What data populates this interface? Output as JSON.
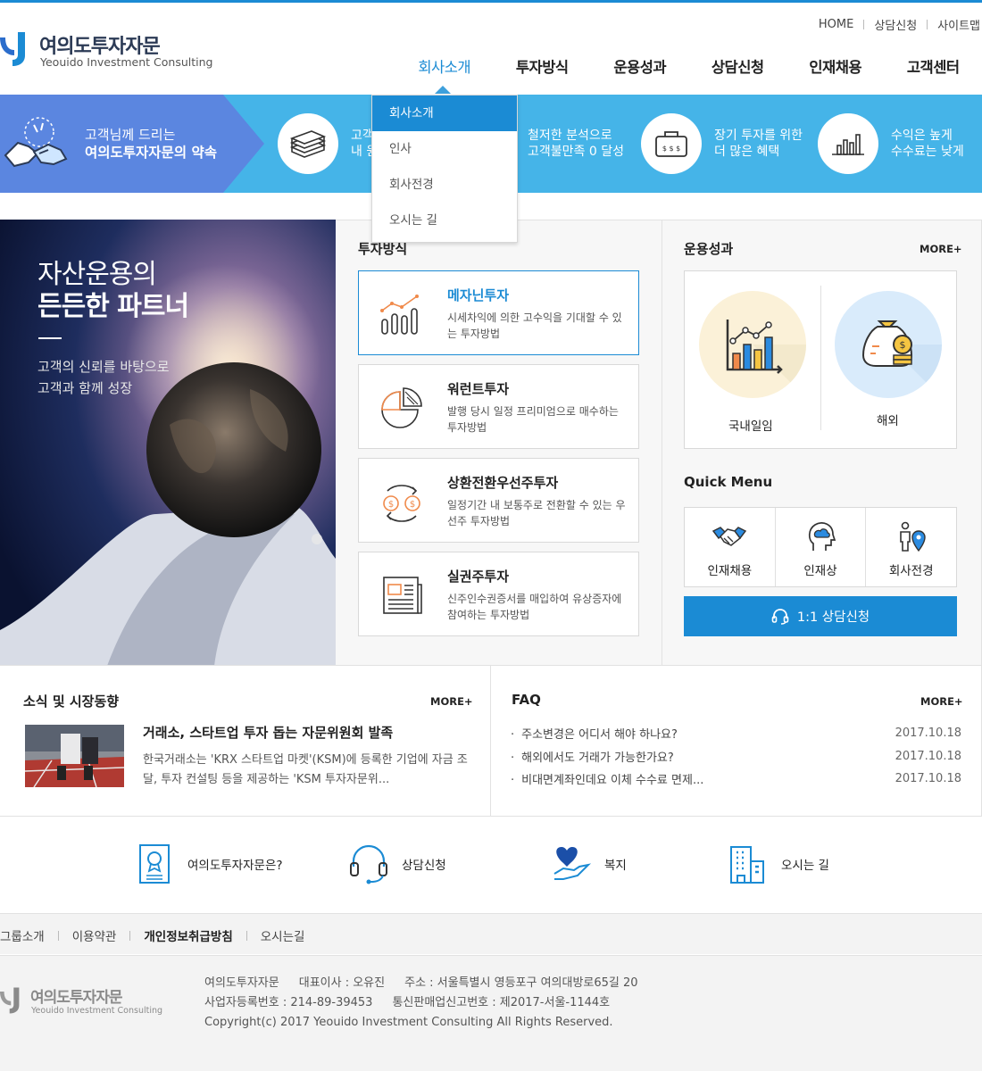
{
  "brand": {
    "name_ko": "여의도투자자문",
    "name_en": "Yeouido Investment Consulting"
  },
  "util_nav": [
    "HOME",
    "상담신청",
    "사이트맵"
  ],
  "gnb": [
    "회사소개",
    "투자방식",
    "운용성과",
    "상담신청",
    "인재채용",
    "고객센터"
  ],
  "gnb_active": "회사소개",
  "dropdown": [
    "회사소개",
    "인사",
    "회사전경",
    "오시는 길"
  ],
  "promise": {
    "title_line1": "고객님께 드리는",
    "title_line2": "여의도투자자문의 약속",
    "items": [
      {
        "icon": "money-stack-icon",
        "line1": "고객",
        "line2": "내 원"
      },
      {
        "icon": "analysis-icon",
        "line1": "철저한 분석으로",
        "line2": "고객불만족 0 달성"
      },
      {
        "icon": "benefit-box-icon",
        "line1": "장기 투자를 위한",
        "line2": "더 많은 혜택"
      },
      {
        "icon": "chart-bars-icon",
        "line1": "수익은 높게",
        "line2": "수수료는 낮게"
      }
    ]
  },
  "hero": {
    "line1": "자산운용의",
    "line2": "든든한 파트너",
    "sub1": "고객의 신뢰를 바탕으로",
    "sub2": "고객과 함께 성장"
  },
  "invest": {
    "title": "투자방식",
    "items": [
      {
        "title": "메자닌투자",
        "desc": "시세차익에 의한 고수익을 기대할 수 있는 투자방법",
        "icon": "line-chart-icon"
      },
      {
        "title": "워런트투자",
        "desc": "발행 당시 일정 프리미엄으로 매수하는 투자방법",
        "icon": "pie-chart-icon"
      },
      {
        "title": "상환전환우선주투자",
        "desc": "일정기간 내 보통주로 전환할 수 있는 우선주 투자방법",
        "icon": "exchange-icon"
      },
      {
        "title": "실권주투자",
        "desc": "신주인수권증서를 매입하여 유상증자에 참여하는 투자방법",
        "icon": "newspaper-icon"
      }
    ]
  },
  "performance": {
    "title": "운용성과",
    "more": "MORE+",
    "items": [
      "국내일임",
      "해외"
    ]
  },
  "quick_menu": {
    "title": "Quick Menu",
    "items": [
      {
        "label": "인재채용",
        "icon": "handshake-icon"
      },
      {
        "label": "인재상",
        "icon": "head-cloud-icon"
      },
      {
        "label": "회사전경",
        "icon": "location-person-icon"
      }
    ],
    "consult_button": "1:1 상담신청"
  },
  "news": {
    "title": "소식 및 시장동향",
    "more": "MORE+",
    "headline": "거래소, 스타트업 투자 돕는 자문위원회 발족",
    "summary": "한국거래소는 'KRX 스타트업 마켓'(KSM)에 등록한 기업에 자금 조달, 투자 컨설팅 등을 제공하는 'KSM 투자자문위..."
  },
  "faq": {
    "title": "FAQ",
    "more": "MORE+",
    "items": [
      {
        "q": "주소변경은 어디서 해야 하나요?",
        "date": "2017.10.18"
      },
      {
        "q": "해외에서도 거래가 가능한가요?",
        "date": "2017.10.18"
      },
      {
        "q": "비대면계좌인데요 이체 수수료 면제...",
        "date": "2017.10.18"
      }
    ]
  },
  "quick_links": [
    {
      "label": "여의도투자자문은?",
      "icon": "certificate-icon"
    },
    {
      "label": "상담신청",
      "icon": "headset-icon"
    },
    {
      "label": "복지",
      "icon": "heart-hand-icon"
    },
    {
      "label": "오시는 길",
      "icon": "building-icon"
    }
  ],
  "footer_nav": [
    "그룹소개",
    "이용약관",
    "개인정보취급방침",
    "오시는길"
  ],
  "footer": {
    "company": "여의도투자자문",
    "ceo": "대표이사 : 오유진",
    "address": "주소 : 서울특별시 영등포구 여의대방로65길 20",
    "biz_no": "사업자등록번호 : 214-89-39453",
    "telecom_no": "통신판매업신고번호 : 제2017-서울-1144호",
    "copyright": "Copyright(c) 2017 Yeouido Investment Consulting  All Rights Reserved."
  },
  "colors": {
    "primary": "#1b8bd4",
    "banner": "#45b4e8",
    "banner_left": "#5b86e0",
    "footer_bg": "#f3f3f3"
  }
}
